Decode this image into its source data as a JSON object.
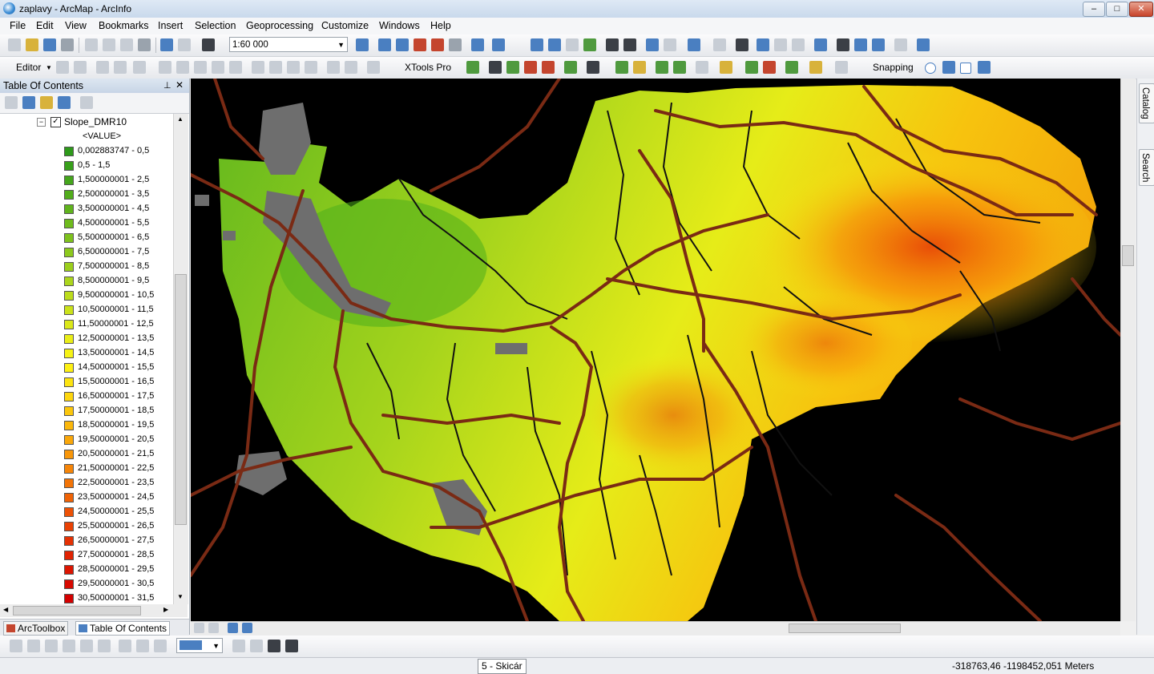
{
  "window": {
    "title": "zaplavy - ArcMap - ArcInfo",
    "min": "–",
    "max": "□",
    "close": "✕"
  },
  "menu": [
    "File",
    "Edit",
    "View",
    "Bookmarks",
    "Insert",
    "Selection",
    "Geoprocessing",
    "Customize",
    "Windows",
    "Help"
  ],
  "toolbar": {
    "scale": "1:60 000",
    "editor": "Editor",
    "xtools": "XTools Pro",
    "snapping": "Snapping"
  },
  "toc": {
    "title": "Table Of Contents",
    "layer": "Slope_DMR10",
    "field": "<VALUE>",
    "legend": [
      {
        "label": "0,002883747 - 0,5",
        "color": "#2e9a1a"
      },
      {
        "label": "0,5 - 1,5",
        "color": "#38a01b"
      },
      {
        "label": "1,500000001 - 2,5",
        "color": "#45a61c"
      },
      {
        "label": "2,500000001 - 3,5",
        "color": "#52ad1c"
      },
      {
        "label": "3,500000001 - 4,5",
        "color": "#60b41d"
      },
      {
        "label": "4,500000001 - 5,5",
        "color": "#6fbb1d"
      },
      {
        "label": "5,500000001 - 6,5",
        "color": "#7ec21d"
      },
      {
        "label": "6,500000001 - 7,5",
        "color": "#8dc91d"
      },
      {
        "label": "7,500000001 - 8,5",
        "color": "#9ccf1d"
      },
      {
        "label": "8,500000001 - 9,5",
        "color": "#acd61c"
      },
      {
        "label": "9,500000001 - 10,5",
        "color": "#bcdc1b"
      },
      {
        "label": "10,50000001 - 11,5",
        "color": "#cbe21a"
      },
      {
        "label": "11,50000001 - 12,5",
        "color": "#dbe819"
      },
      {
        "label": "12,50000001 - 13,5",
        "color": "#eaee17"
      },
      {
        "label": "13,50000001 - 14,5",
        "color": "#f6f315"
      },
      {
        "label": "14,50000001 - 15,5",
        "color": "#fdf013"
      },
      {
        "label": "15,50000001 - 16,5",
        "color": "#fde410"
      },
      {
        "label": "16,50000001 - 17,5",
        "color": "#fdd60e"
      },
      {
        "label": "17,50000001 - 18,5",
        "color": "#fcc70c"
      },
      {
        "label": "18,50000001 - 19,5",
        "color": "#fbb70b"
      },
      {
        "label": "19,50000001 - 20,5",
        "color": "#faa70a"
      },
      {
        "label": "20,50000001 - 21,5",
        "color": "#f89609"
      },
      {
        "label": "21,50000001 - 22,5",
        "color": "#f68508"
      },
      {
        "label": "22,50000001 - 23,5",
        "color": "#f37407"
      },
      {
        "label": "23,50000001 - 24,5",
        "color": "#f06306"
      },
      {
        "label": "24,50000001 - 25,5",
        "color": "#ed5205"
      },
      {
        "label": "25,50000001 - 26,5",
        "color": "#e94104"
      },
      {
        "label": "26,50000001 - 27,5",
        "color": "#e53103"
      },
      {
        "label": "27,50000001 - 28,5",
        "color": "#e12302"
      },
      {
        "label": "28,50000001 - 29,5",
        "color": "#dc1501"
      },
      {
        "label": "29,50000001 - 30,5",
        "color": "#d80a01"
      },
      {
        "label": "30,50000001 - 31,5",
        "color": "#d40000"
      }
    ],
    "tabs": [
      "ArcToolbox",
      "Table Of Contents"
    ]
  },
  "rightdock": [
    "Catalog",
    "Search"
  ],
  "status": {
    "task": "5 - Skicár",
    "coords": "-318763,46  -1198452,051 Meters"
  },
  "colors": {
    "road": "#7a2a14",
    "stream": "#111111",
    "urban": "#6e6e6e",
    "background": "#000000"
  }
}
